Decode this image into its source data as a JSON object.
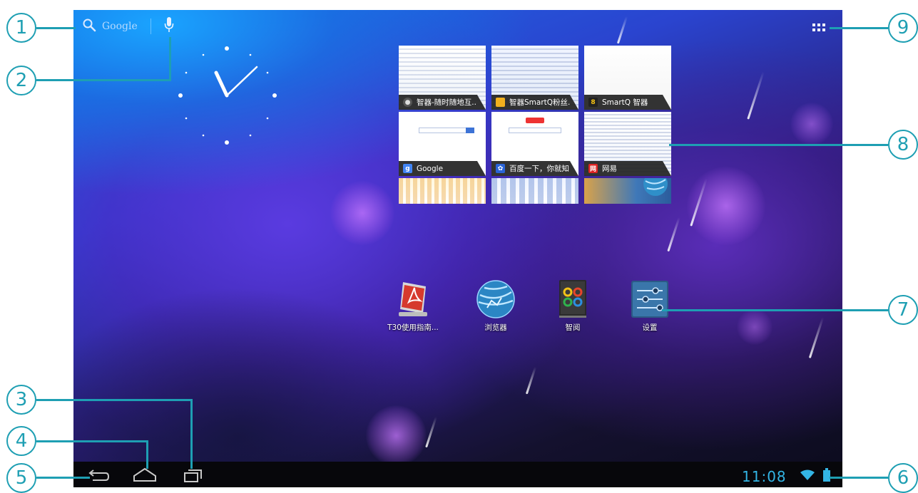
{
  "search": {
    "label": "Google"
  },
  "thumbnails": [
    {
      "title": "智器-随时随地互...",
      "icon": "globe-icon"
    },
    {
      "title": "智器SmartQ粉丝...",
      "icon": "folder-icon"
    },
    {
      "title": "SmartQ 智器",
      "icon": "smartq-icon"
    },
    {
      "title": "Google",
      "icon": "google-icon"
    },
    {
      "title": "百度一下，你就知...",
      "icon": "baidu-icon"
    },
    {
      "title": "网易",
      "icon": "netease-icon"
    }
  ],
  "apps": [
    {
      "label": "T30使用指南..."
    },
    {
      "label": "浏览器"
    },
    {
      "label": "智阅"
    },
    {
      "label": "设置"
    }
  ],
  "status": {
    "time": "11:08"
  },
  "callouts": [
    "1",
    "2",
    "3",
    "4",
    "5",
    "6",
    "7",
    "8",
    "9"
  ],
  "colors": {
    "accent": "#33b5e5",
    "callout": "#1e9fb3"
  }
}
